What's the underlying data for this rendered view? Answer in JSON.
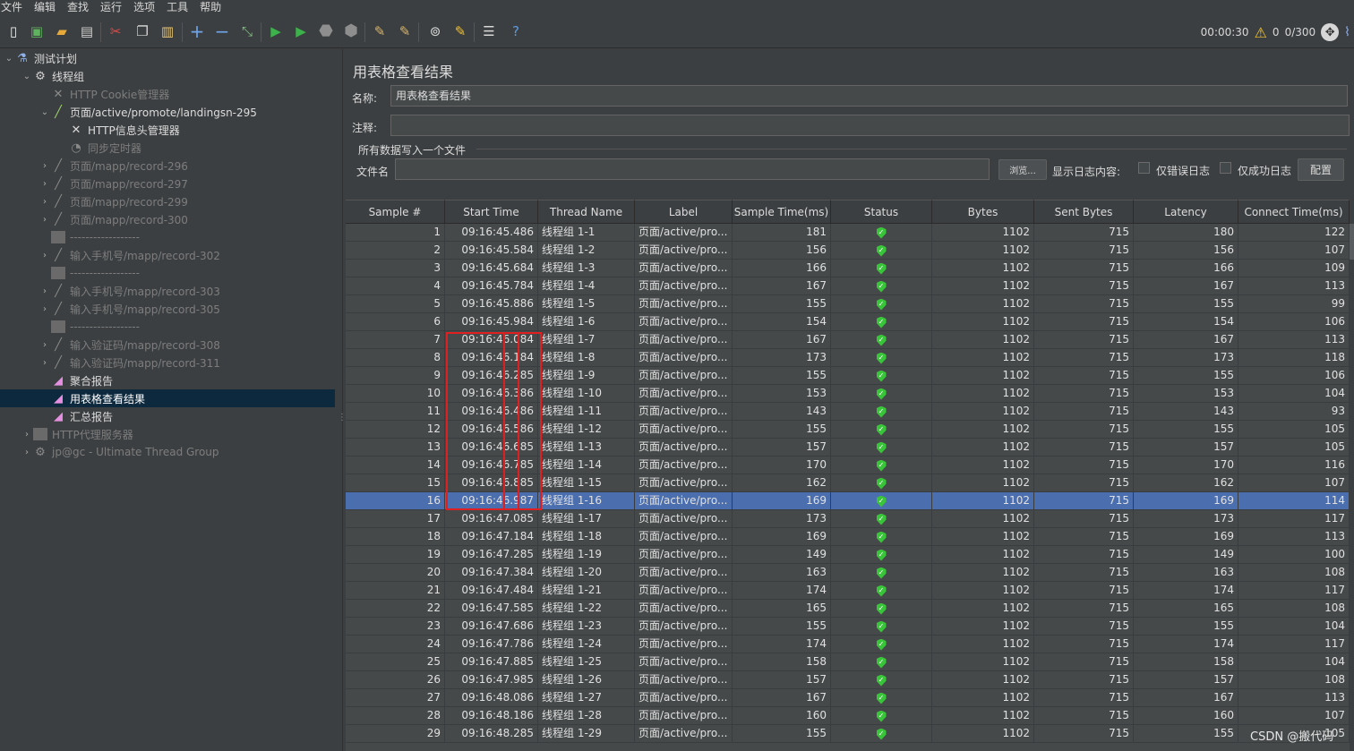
{
  "menu": [
    "文件",
    "编辑",
    "查找",
    "运行",
    "选项",
    "工具",
    "帮助"
  ],
  "toolbar": {
    "timer": "00:00:30",
    "warning_count": "0",
    "threads": "0/300",
    "icons": [
      "new-icon",
      "templates-icon",
      "open-icon",
      "save-icon",
      "cut-icon",
      "copy-icon",
      "paste-icon",
      "expand-icon",
      "collapse-icon",
      "toggle-icon",
      "start-icon",
      "start-no-pause-icon",
      "stop-icon",
      "shutdown-icon",
      "clear-icon",
      "clear-all-icon",
      "search-icon",
      "reset-search-icon",
      "function-helper-icon",
      "help-icon"
    ]
  },
  "tree": [
    {
      "label": "测试计划",
      "depth": 0,
      "arrow": "v",
      "icon": "test-plan-icon",
      "glyph": "⚗",
      "state": "enabled"
    },
    {
      "label": "线程组",
      "depth": 1,
      "arrow": "v",
      "icon": "gear-icon",
      "glyph": "⚙",
      "state": "enabled"
    },
    {
      "label": "HTTP Cookie管理器",
      "depth": 2,
      "arrow": "",
      "icon": "wrench-icon",
      "glyph": "✕",
      "state": "disabled"
    },
    {
      "label": "页面/active/promote/landingsn-295",
      "depth": 2,
      "arrow": "v",
      "icon": "sampler-icon",
      "glyph": "╱",
      "state": "enabled"
    },
    {
      "label": "HTTP信息头管理器",
      "depth": 3,
      "arrow": "",
      "icon": "wrench-icon",
      "glyph": "✕",
      "state": "enabled"
    },
    {
      "label": "同步定时器",
      "depth": 3,
      "arrow": "",
      "icon": "timer-icon",
      "glyph": "◔",
      "state": "disabled"
    },
    {
      "label": "页面/mapp/record-296",
      "depth": 2,
      "arrow": ">",
      "icon": "sampler-icon",
      "glyph": "╱",
      "state": "disabled"
    },
    {
      "label": "页面/mapp/record-297",
      "depth": 2,
      "arrow": ">",
      "icon": "sampler-icon",
      "glyph": "╱",
      "state": "disabled"
    },
    {
      "label": "页面/mapp/record-299",
      "depth": 2,
      "arrow": ">",
      "icon": "sampler-icon",
      "glyph": "╱",
      "state": "disabled"
    },
    {
      "label": "页面/mapp/record-300",
      "depth": 2,
      "arrow": ">",
      "icon": "sampler-icon",
      "glyph": "╱",
      "state": "disabled"
    },
    {
      "label": "------------------",
      "depth": 2,
      "arrow": "",
      "icon": "controller-icon",
      "glyph": "box",
      "state": "disabled"
    },
    {
      "label": "输入手机号/mapp/record-302",
      "depth": 2,
      "arrow": ">",
      "icon": "sampler-icon",
      "glyph": "╱",
      "state": "disabled"
    },
    {
      "label": "------------------",
      "depth": 2,
      "arrow": "",
      "icon": "controller-icon",
      "glyph": "box",
      "state": "disabled"
    },
    {
      "label": "输入手机号/mapp/record-303",
      "depth": 2,
      "arrow": ">",
      "icon": "sampler-icon",
      "glyph": "╱",
      "state": "disabled"
    },
    {
      "label": "输入手机号/mapp/record-305",
      "depth": 2,
      "arrow": ">",
      "icon": "sampler-icon",
      "glyph": "╱",
      "state": "disabled"
    },
    {
      "label": "------------------",
      "depth": 2,
      "arrow": "",
      "icon": "controller-icon",
      "glyph": "box",
      "state": "disabled"
    },
    {
      "label": "输入验证码/mapp/record-308",
      "depth": 2,
      "arrow": ">",
      "icon": "sampler-icon",
      "glyph": "╱",
      "state": "disabled"
    },
    {
      "label": "输入验证码/mapp/record-311",
      "depth": 2,
      "arrow": ">",
      "icon": "sampler-icon",
      "glyph": "╱",
      "state": "disabled"
    },
    {
      "label": "聚合报告",
      "depth": 2,
      "arrow": "",
      "icon": "chart-icon",
      "glyph": "◢",
      "state": "enabled"
    },
    {
      "label": "用表格查看结果",
      "depth": 2,
      "arrow": "",
      "icon": "chart-icon",
      "glyph": "◢",
      "state": "selected"
    },
    {
      "label": "汇总报告",
      "depth": 2,
      "arrow": "",
      "icon": "chart-icon",
      "glyph": "◢",
      "state": "enabled"
    },
    {
      "label": "HTTP代理服务器",
      "depth": 1,
      "arrow": ">",
      "icon": "proxy-icon",
      "glyph": "box",
      "state": "disabled"
    },
    {
      "label": "jp@gc - Ultimate Thread Group",
      "depth": 1,
      "arrow": ">",
      "icon": "gear-icon",
      "glyph": "⚙",
      "state": "disabled"
    }
  ],
  "panel": {
    "title": "用表格查看结果",
    "name_label": "名称:",
    "name_value": "用表格查看结果",
    "comment_label": "注释:",
    "comment_value": "",
    "file_group_label": "所有数据写入一个文件",
    "filename_label": "文件名",
    "filename_value": "",
    "browse_button": "浏览...",
    "log_label": "显示日志内容:",
    "errors_only_label": "仅错误日志",
    "success_only_label": "仅成功日志",
    "configure_button": "配置"
  },
  "table": {
    "columns": [
      "Sample #",
      "Start Time",
      "Thread Name",
      "Label",
      "Sample Time(ms)",
      "Status",
      "Bytes",
      "Sent Bytes",
      "Latency",
      "Connect Time(ms)"
    ],
    "selected_row": 16,
    "rows": [
      [
        "1",
        "09:16:45.486",
        "线程组 1-1",
        "页面/active/pro...",
        "181",
        "ok",
        "1102",
        "715",
        "180",
        "122"
      ],
      [
        "2",
        "09:16:45.584",
        "线程组 1-2",
        "页面/active/pro...",
        "156",
        "ok",
        "1102",
        "715",
        "156",
        "107"
      ],
      [
        "3",
        "09:16:45.684",
        "线程组 1-3",
        "页面/active/pro...",
        "166",
        "ok",
        "1102",
        "715",
        "166",
        "109"
      ],
      [
        "4",
        "09:16:45.784",
        "线程组 1-4",
        "页面/active/pro...",
        "167",
        "ok",
        "1102",
        "715",
        "167",
        "113"
      ],
      [
        "5",
        "09:16:45.886",
        "线程组 1-5",
        "页面/active/pro...",
        "155",
        "ok",
        "1102",
        "715",
        "155",
        "99"
      ],
      [
        "6",
        "09:16:45.984",
        "线程组 1-6",
        "页面/active/pro...",
        "154",
        "ok",
        "1102",
        "715",
        "154",
        "106"
      ],
      [
        "7",
        "09:16:46.084",
        "线程组 1-7",
        "页面/active/pro...",
        "167",
        "ok",
        "1102",
        "715",
        "167",
        "113"
      ],
      [
        "8",
        "09:16:46.184",
        "线程组 1-8",
        "页面/active/pro...",
        "173",
        "ok",
        "1102",
        "715",
        "173",
        "118"
      ],
      [
        "9",
        "09:16:46.285",
        "线程组 1-9",
        "页面/active/pro...",
        "155",
        "ok",
        "1102",
        "715",
        "155",
        "106"
      ],
      [
        "10",
        "09:16:46.386",
        "线程组 1-10",
        "页面/active/pro...",
        "153",
        "ok",
        "1102",
        "715",
        "153",
        "104"
      ],
      [
        "11",
        "09:16:46.486",
        "线程组 1-11",
        "页面/active/pro...",
        "143",
        "ok",
        "1102",
        "715",
        "143",
        "93"
      ],
      [
        "12",
        "09:16:46.586",
        "线程组 1-12",
        "页面/active/pro...",
        "155",
        "ok",
        "1102",
        "715",
        "155",
        "105"
      ],
      [
        "13",
        "09:16:46.685",
        "线程组 1-13",
        "页面/active/pro...",
        "157",
        "ok",
        "1102",
        "715",
        "157",
        "105"
      ],
      [
        "14",
        "09:16:46.785",
        "线程组 1-14",
        "页面/active/pro...",
        "170",
        "ok",
        "1102",
        "715",
        "170",
        "116"
      ],
      [
        "15",
        "09:16:46.885",
        "线程组 1-15",
        "页面/active/pro...",
        "162",
        "ok",
        "1102",
        "715",
        "162",
        "107"
      ],
      [
        "16",
        "09:16:46.987",
        "线程组 1-16",
        "页面/active/pro...",
        "169",
        "ok",
        "1102",
        "715",
        "169",
        "114"
      ],
      [
        "17",
        "09:16:47.085",
        "线程组 1-17",
        "页面/active/pro...",
        "173",
        "ok",
        "1102",
        "715",
        "173",
        "117"
      ],
      [
        "18",
        "09:16:47.184",
        "线程组 1-18",
        "页面/active/pro...",
        "169",
        "ok",
        "1102",
        "715",
        "169",
        "113"
      ],
      [
        "19",
        "09:16:47.285",
        "线程组 1-19",
        "页面/active/pro...",
        "149",
        "ok",
        "1102",
        "715",
        "149",
        "100"
      ],
      [
        "20",
        "09:16:47.384",
        "线程组 1-20",
        "页面/active/pro...",
        "163",
        "ok",
        "1102",
        "715",
        "163",
        "108"
      ],
      [
        "21",
        "09:16:47.484",
        "线程组 1-21",
        "页面/active/pro...",
        "174",
        "ok",
        "1102",
        "715",
        "174",
        "117"
      ],
      [
        "22",
        "09:16:47.585",
        "线程组 1-22",
        "页面/active/pro...",
        "165",
        "ok",
        "1102",
        "715",
        "165",
        "108"
      ],
      [
        "23",
        "09:16:47.686",
        "线程组 1-23",
        "页面/active/pro...",
        "155",
        "ok",
        "1102",
        "715",
        "155",
        "104"
      ],
      [
        "24",
        "09:16:47.786",
        "线程组 1-24",
        "页面/active/pro...",
        "174",
        "ok",
        "1102",
        "715",
        "174",
        "117"
      ],
      [
        "25",
        "09:16:47.885",
        "线程组 1-25",
        "页面/active/pro...",
        "158",
        "ok",
        "1102",
        "715",
        "158",
        "104"
      ],
      [
        "26",
        "09:16:47.985",
        "线程组 1-26",
        "页面/active/pro...",
        "157",
        "ok",
        "1102",
        "715",
        "157",
        "108"
      ],
      [
        "27",
        "09:16:48.086",
        "线程组 1-27",
        "页面/active/pro...",
        "167",
        "ok",
        "1102",
        "715",
        "167",
        "113"
      ],
      [
        "28",
        "09:16:48.186",
        "线程组 1-28",
        "页面/active/pro...",
        "160",
        "ok",
        "1102",
        "715",
        "160",
        "107"
      ],
      [
        "29",
        "09:16:48.285",
        "线程组 1-29",
        "页面/active/pro...",
        "155",
        "ok",
        "1102",
        "715",
        "155",
        "105"
      ]
    ]
  },
  "watermark": "CSDN @搬代码",
  "colors": {
    "selection": "#4b6eaf",
    "tree_selection": "#0d293e",
    "status_ok": "#3ac43a",
    "highlight_box": "#e02020"
  }
}
